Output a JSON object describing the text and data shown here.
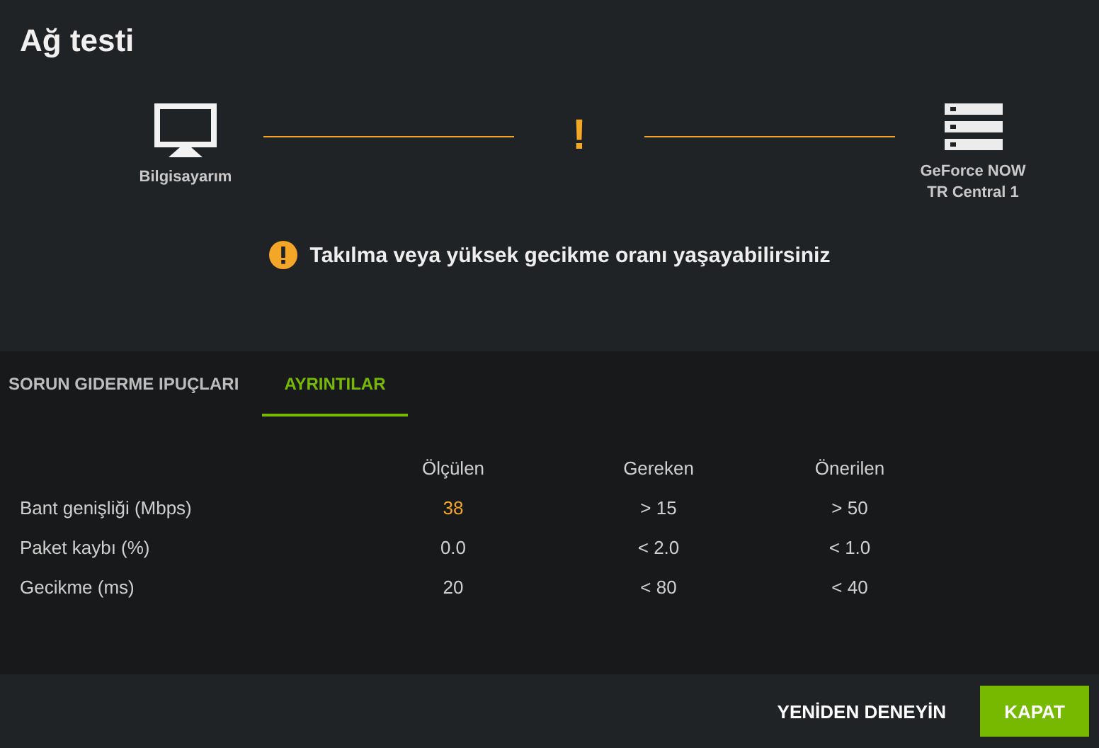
{
  "window": {
    "title": "Ağ testi"
  },
  "diagram": {
    "source": {
      "label": "Bilgisayarım"
    },
    "status": {
      "symbol": "!",
      "warning": true
    },
    "target": {
      "label_lines": [
        "GeForce NOW",
        "TR Central 1"
      ]
    }
  },
  "alert": {
    "text": "Takılma veya yüksek gecikme oranı yaşayabilirsiniz",
    "warning": true
  },
  "tabs": [
    {
      "label": "SORUN GIDERME IPUÇLARI",
      "selected": false
    },
    {
      "label": "AYRINTILAR",
      "selected": true
    }
  ],
  "table": {
    "columns": [
      "Ölçülen",
      "Gereken",
      "Önerilen"
    ],
    "rows": [
      {
        "label": "Bant genişliği (Mbps)",
        "measured": "38",
        "warning": true,
        "required": "> 15",
        "recommended": "> 50"
      },
      {
        "label": "Paket kaybı (%)",
        "measured": "0.0",
        "warning": false,
        "required": "< 2.0",
        "recommended": "< 1.0"
      },
      {
        "label": "Gecikme (ms)",
        "measured": "20",
        "warning": false,
        "required": "< 80",
        "recommended": "< 40"
      }
    ]
  },
  "buttons": [
    {
      "label": "YENİDEN DENEYİN",
      "kind": "text"
    },
    {
      "label": "KAPAT",
      "kind": "primary"
    }
  ]
}
